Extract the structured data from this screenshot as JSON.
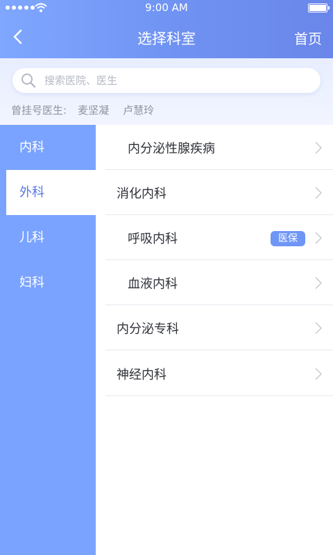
{
  "status_bar": {
    "time": "9:00 AM"
  },
  "nav": {
    "title": "选择科室",
    "home_label": "首页"
  },
  "search": {
    "placeholder": "搜索医院、医生",
    "value": ""
  },
  "history": {
    "label": "曾挂号医生:",
    "doctors": [
      "麦坚凝",
      "卢慧玲"
    ]
  },
  "sidebar": {
    "items": [
      {
        "label": "内科",
        "active": false
      },
      {
        "label": "外科",
        "active": true
      },
      {
        "label": "儿科",
        "active": false
      },
      {
        "label": "妇科",
        "active": false
      }
    ]
  },
  "departments": [
    {
      "label": "内分泌性腺疾病",
      "badge": ""
    },
    {
      "label": "消化内科",
      "badge": ""
    },
    {
      "label": "呼吸内科",
      "badge": "医保"
    },
    {
      "label": "血液内科",
      "badge": ""
    },
    {
      "label": "内分泌专科",
      "badge": ""
    },
    {
      "label": "神经内科",
      "badge": ""
    }
  ],
  "colors": {
    "accent": "#6f92f2",
    "sidebar": "#7aa3ff",
    "active_text": "#5877e3",
    "badge": "#6f95f5"
  }
}
